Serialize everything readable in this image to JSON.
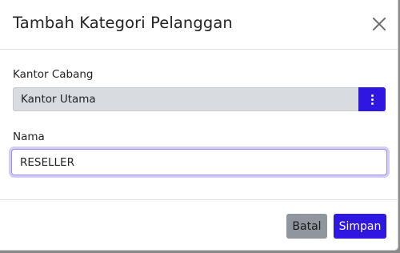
{
  "modal": {
    "title": "Tambah Kategori Pelanggan",
    "close_icon": "close-icon"
  },
  "form": {
    "kantor_cabang": {
      "label": "Kantor Cabang",
      "value": "Kantor Utama",
      "button_icon": "vertical-dots-icon"
    },
    "nama": {
      "label": "Nama",
      "value": "RESELLER"
    }
  },
  "footer": {
    "cancel_label": "Batal",
    "save_label": "Simpan"
  },
  "colors": {
    "primary": "#2f17e2",
    "secondary": "#8f969e",
    "readonly_bg": "#d8dbe0"
  }
}
